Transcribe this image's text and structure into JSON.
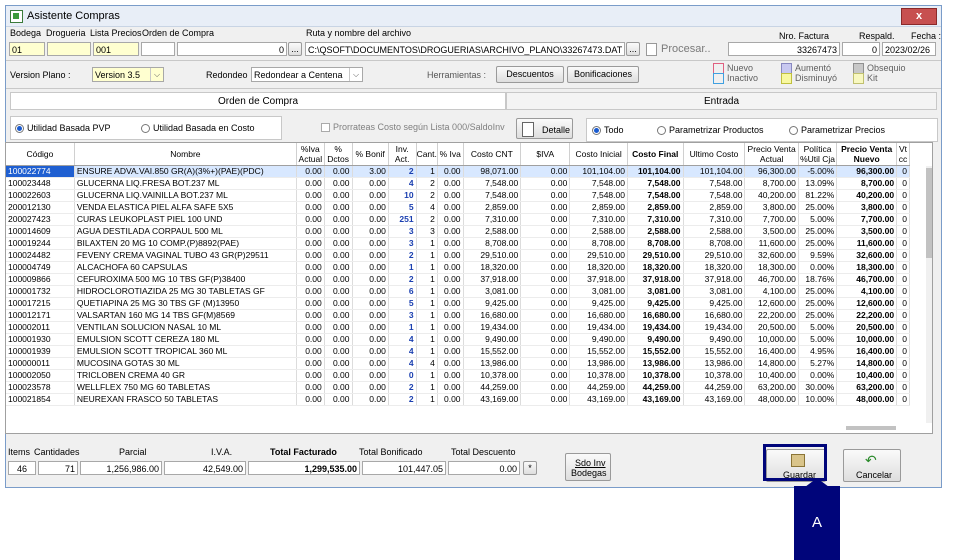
{
  "window": {
    "title": "Asistente Compras",
    "close_label": "x"
  },
  "header": {
    "labels": {
      "bodega": "Bodega",
      "drogueria": "Drogueria",
      "lista_precios": "Lista Precios",
      "orden_compra": "Orden de Compra",
      "ruta": "Ruta y nombre del archivo",
      "nro_factura": "Nro. Factura",
      "respald": "Respald.",
      "fecha": "Fecha :"
    },
    "values": {
      "bodega": "01",
      "lista_precios": "001",
      "orden_compra": "0",
      "ruta": "C:\\QSOFT\\DOCUMENTOS\\DROGUERIAS\\ARCHIVO_PLANO\\33267473.DAT",
      "nro_factura": "33267473",
      "respald": "0",
      "fecha": "2023/02/26"
    },
    "browse_label": "...",
    "procesar_label": "Procesar.."
  },
  "row2": {
    "version_label": "Version Plano :",
    "version_value": "Version 3.5",
    "redondeo_label": "Redondeo",
    "redondeo_value": "Redondear a Centena",
    "herramientas_label": "Herramientas :",
    "descuentos_label": "Descuentos",
    "bonificaciones_label": "Bonificaciones",
    "legend": [
      {
        "label": "Nuevo",
        "color": "#ffffff",
        "border": "#e06080"
      },
      {
        "label": "Inactivo",
        "color": "#ffffff",
        "border": "#40a0e0"
      },
      {
        "label": "Aumentó",
        "color": "#c8c8f0",
        "border": "#8888c0"
      },
      {
        "label": "Disminuyó",
        "color": "#f8f8a0",
        "border": "#c0c040"
      },
      {
        "label": "Obsequio",
        "color": "#c8c8c8",
        "border": "#909090"
      },
      {
        "label": "Kit",
        "color": "#f8f8c0",
        "border": "#c0c070"
      }
    ]
  },
  "tabs": {
    "orden": "Orden de Compra",
    "entrada": "Entrada"
  },
  "options": {
    "utilidad_pvp": "Utilidad Basada PVP",
    "utilidad_costo": "Utilidad Basada en Costo",
    "prorrateo": "Prorrateas Costo según Lista 000/SaldoInv",
    "detalle": "Detalle",
    "todo": "Todo",
    "param_productos": "Parametrizar Productos",
    "param_precios": "Parametrizar Precios"
  },
  "table": {
    "headers": [
      "Código",
      "Nombre",
      "%Iva Actual",
      "% Dctos",
      "% Bonif",
      "Inv. Act.",
      "Cant.",
      "% Iva",
      "Costo CNT",
      "$IVA",
      "Costo Inicial",
      "Costo Final",
      "Ultimo Costo",
      "Precio Venta Actual",
      "Política %Util Cja",
      "Precio Venta Nuevo",
      "Vt cc"
    ],
    "rows": [
      [
        "100022774",
        "ENSURE ADVA.VAI.850 GR(A)(3%+)(PAE)(PDC)",
        "0.00",
        "0.00",
        "3.00",
        "2",
        "1",
        "0.00",
        "98,071.00",
        "0.00",
        "101,104.00",
        "101,104.00",
        "101,104.00",
        "96,300.00",
        "-5.00%",
        "96,300.00",
        "0"
      ],
      [
        "100023448",
        "GLUCERNA LIQ.FRESA BOT.237 ML",
        "0.00",
        "0.00",
        "0.00",
        "4",
        "2",
        "0.00",
        "7,548.00",
        "0.00",
        "7,548.00",
        "7,548.00",
        "7,548.00",
        "8,700.00",
        "13.09%",
        "8,700.00",
        "0"
      ],
      [
        "100022603",
        "GLUCERNA LIQ.VAINILLA BOT.237 ML",
        "0.00",
        "0.00",
        "0.00",
        "10",
        "2",
        "0.00",
        "7,548.00",
        "0.00",
        "7,548.00",
        "7,548.00",
        "7,548.00",
        "40,200.00",
        "81.22%",
        "40,200.00",
        "0"
      ],
      [
        "200012130",
        "VENDA ELASTICA PIEL ALFA SAFE 5X5",
        "0.00",
        "0.00",
        "0.00",
        "5",
        "4",
        "0.00",
        "2,859.00",
        "0.00",
        "2,859.00",
        "2,859.00",
        "2,859.00",
        "3,800.00",
        "25.00%",
        "3,800.00",
        "0"
      ],
      [
        "200027423",
        "CURAS LEUKOPLAST PIEL 100 UND",
        "0.00",
        "0.00",
        "0.00",
        "251",
        "2",
        "0.00",
        "7,310.00",
        "0.00",
        "7,310.00",
        "7,310.00",
        "7,310.00",
        "7,700.00",
        "5.00%",
        "7,700.00",
        "0"
      ],
      [
        "100014609",
        "AGUA DESTILADA CORPAUL 500 ML",
        "0.00",
        "0.00",
        "0.00",
        "3",
        "3",
        "0.00",
        "2,588.00",
        "0.00",
        "2,588.00",
        "2,588.00",
        "2,588.00",
        "3,500.00",
        "25.00%",
        "3,500.00",
        "0"
      ],
      [
        "100019244",
        "BILAXTEN 20 MG 10 COMP.(P)8892(PAE)",
        "0.00",
        "0.00",
        "0.00",
        "3",
        "1",
        "0.00",
        "8,708.00",
        "0.00",
        "8,708.00",
        "8,708.00",
        "8,708.00",
        "11,600.00",
        "25.00%",
        "11,600.00",
        "0"
      ],
      [
        "100024482",
        "FEVENY CREMA VAGINAL TUBO 43 GR(P)29511",
        "0.00",
        "0.00",
        "0.00",
        "2",
        "1",
        "0.00",
        "29,510.00",
        "0.00",
        "29,510.00",
        "29,510.00",
        "29,510.00",
        "32,600.00",
        "9.59%",
        "32,600.00",
        "0"
      ],
      [
        "100004749",
        "ALCACHOFA 60 CAPSULAS",
        "0.00",
        "0.00",
        "0.00",
        "1",
        "1",
        "0.00",
        "18,320.00",
        "0.00",
        "18,320.00",
        "18,320.00",
        "18,320.00",
        "18,300.00",
        "0.00%",
        "18,300.00",
        "0"
      ],
      [
        "100009866",
        "CEFUROXIMA 500 MG 10 TBS GF(P)38400",
        "0.00",
        "0.00",
        "0.00",
        "2",
        "1",
        "0.00",
        "37,918.00",
        "0.00",
        "37,918.00",
        "37,918.00",
        "37,918.00",
        "46,700.00",
        "18.76%",
        "46,700.00",
        "0"
      ],
      [
        "100001732",
        "HIDROCLOROTIAZIDA 25 MG 30 TABLETAS GF",
        "0.00",
        "0.00",
        "0.00",
        "6",
        "1",
        "0.00",
        "3,081.00",
        "0.00",
        "3,081.00",
        "3,081.00",
        "3,081.00",
        "4,100.00",
        "25.00%",
        "4,100.00",
        "0"
      ],
      [
        "100017215",
        "QUETIAPINA 25 MG 30 TBS GF (M)13950",
        "0.00",
        "0.00",
        "0.00",
        "5",
        "1",
        "0.00",
        "9,425.00",
        "0.00",
        "9,425.00",
        "9,425.00",
        "9,425.00",
        "12,600.00",
        "25.00%",
        "12,600.00",
        "0"
      ],
      [
        "100012171",
        "VALSARTAN 160 MG 14 TBS GF(M)8569",
        "0.00",
        "0.00",
        "0.00",
        "3",
        "1",
        "0.00",
        "16,680.00",
        "0.00",
        "16,680.00",
        "16,680.00",
        "16,680.00",
        "22,200.00",
        "25.00%",
        "22,200.00",
        "0"
      ],
      [
        "100002011",
        "VENTILAN SOLUCION NASAL 10 ML",
        "0.00",
        "0.00",
        "0.00",
        "1",
        "1",
        "0.00",
        "19,434.00",
        "0.00",
        "19,434.00",
        "19,434.00",
        "19,434.00",
        "20,500.00",
        "5.00%",
        "20,500.00",
        "0"
      ],
      [
        "100001930",
        "EMULSION SCOTT CEREZA 180 ML",
        "0.00",
        "0.00",
        "0.00",
        "4",
        "1",
        "0.00",
        "9,490.00",
        "0.00",
        "9,490.00",
        "9,490.00",
        "9,490.00",
        "10,000.00",
        "5.00%",
        "10,000.00",
        "0"
      ],
      [
        "100001939",
        "EMULSION SCOTT TROPICAL 360 ML",
        "0.00",
        "0.00",
        "0.00",
        "4",
        "1",
        "0.00",
        "15,552.00",
        "0.00",
        "15,552.00",
        "15,552.00",
        "15,552.00",
        "16,400.00",
        "4.95%",
        "16,400.00",
        "0"
      ],
      [
        "100000011",
        "MUCOSINA GOTAS 30 ML",
        "0.00",
        "0.00",
        "0.00",
        "4",
        "4",
        "0.00",
        "13,986.00",
        "0.00",
        "13,986.00",
        "13,986.00",
        "13,986.00",
        "14,800.00",
        "5.27%",
        "14,800.00",
        "0"
      ],
      [
        "100002050",
        "TRICLOBEN CREMA 40 GR",
        "0.00",
        "0.00",
        "0.00",
        "0",
        "1",
        "0.00",
        "10,378.00",
        "0.00",
        "10,378.00",
        "10,378.00",
        "10,378.00",
        "10,400.00",
        "0.00%",
        "10,400.00",
        "0"
      ],
      [
        "100023578",
        "WELLFLEX 750 MG 60 TABLETAS",
        "0.00",
        "0.00",
        "0.00",
        "2",
        "1",
        "0.00",
        "44,259.00",
        "0.00",
        "44,259.00",
        "44,259.00",
        "44,259.00",
        "63,200.00",
        "30.00%",
        "63,200.00",
        "0"
      ],
      [
        "100021854",
        "NEUREXAN FRASCO 50 TABLETAS",
        "0.00",
        "0.00",
        "0.00",
        "2",
        "1",
        "0.00",
        "43,169.00",
        "0.00",
        "43,169.00",
        "43,169.00",
        "43,169.00",
        "48,000.00",
        "10.00%",
        "48,000.00",
        "0"
      ]
    ]
  },
  "totals": {
    "labels": {
      "items": "Items",
      "cantidades": "Cantidades",
      "parcial": "Parcial",
      "iva": "I.V.A.",
      "total_facturado": "Total Facturado",
      "total_bonificado": "Total Bonificado",
      "total_descuento": "Total Descuento"
    },
    "values": {
      "items": "46",
      "cantidades": "71",
      "parcial": "1,256,986.00",
      "iva": "42,549.00",
      "total_facturado": "1,299,535.00",
      "total_bonificado": "101,447.05",
      "total_descuento": "0.00"
    },
    "star_label": "*",
    "sdo_inv_label_1": "Sdo Inv",
    "sdo_inv_label_2": "Bodegas"
  },
  "actions": {
    "guardar": "Guardar",
    "cancelar": "Cancelar"
  },
  "callout": {
    "label": "A"
  }
}
